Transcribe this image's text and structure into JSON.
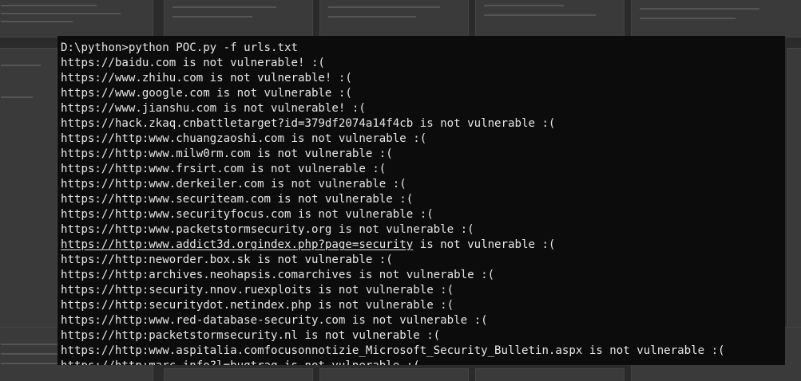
{
  "terminal": {
    "command_line": "D:\\python>python POC.py -f urls.txt",
    "lines": [
      {
        "text": "https://baidu.com is not vulnerable! :("
      },
      {
        "text": "https://www.zhihu.com is not vulnerable! :("
      },
      {
        "text": "https://www.google.com is not vulnerable :("
      },
      {
        "text": "https://www.jianshu.com is not vulnerable! :("
      },
      {
        "text": "https://hack.zkaq.cnbattletarget?id=379df2074a14f4cb is not vulnerable :("
      },
      {
        "text": "https://http:www.chuangzaoshi.com is not vulnerable :("
      },
      {
        "text": "https://http:www.milw0rm.com is not vulnerable :("
      },
      {
        "text": "https://http:www.frsirt.com is not vulnerable :("
      },
      {
        "text": "https://http:www.derkeiler.com is not vulnerable :("
      },
      {
        "text": "https://http:www.securiteam.com is not vulnerable :("
      },
      {
        "text": "https://http:www.securityfocus.com is not vulnerable :("
      },
      {
        "text": "https://http:www.packetstormsecurity.org is not vulnerable :("
      },
      {
        "link": "https://http:www.addict3d.orgindex.php?page=security",
        "text": " is not vulnerable :("
      },
      {
        "text": "https://http:neworder.box.sk is not vulnerable :("
      },
      {
        "text": "https://http:archives.neohapsis.comarchives is not vulnerable :("
      },
      {
        "text": "https://http:security.nnov.ruexploits is not vulnerable :("
      },
      {
        "text": "https://http:securitydot.netindex.php is not vulnerable :("
      },
      {
        "text": "https://http:www.red-database-security.com is not vulnerable :("
      },
      {
        "text": "https://http:packetstormsecurity.nl is not vulnerable :("
      },
      {
        "text": "https://http:www.aspitalia.comfocusonnotizie_Microsoft_Security_Bulletin.aspx is not vulnerable :("
      },
      {
        "text": "https://http:marc.info?l=bugtraq is not vulnerable :("
      }
    ],
    "colors": {
      "background": "#0c0c0c",
      "foreground": "#e6e6e6"
    }
  }
}
